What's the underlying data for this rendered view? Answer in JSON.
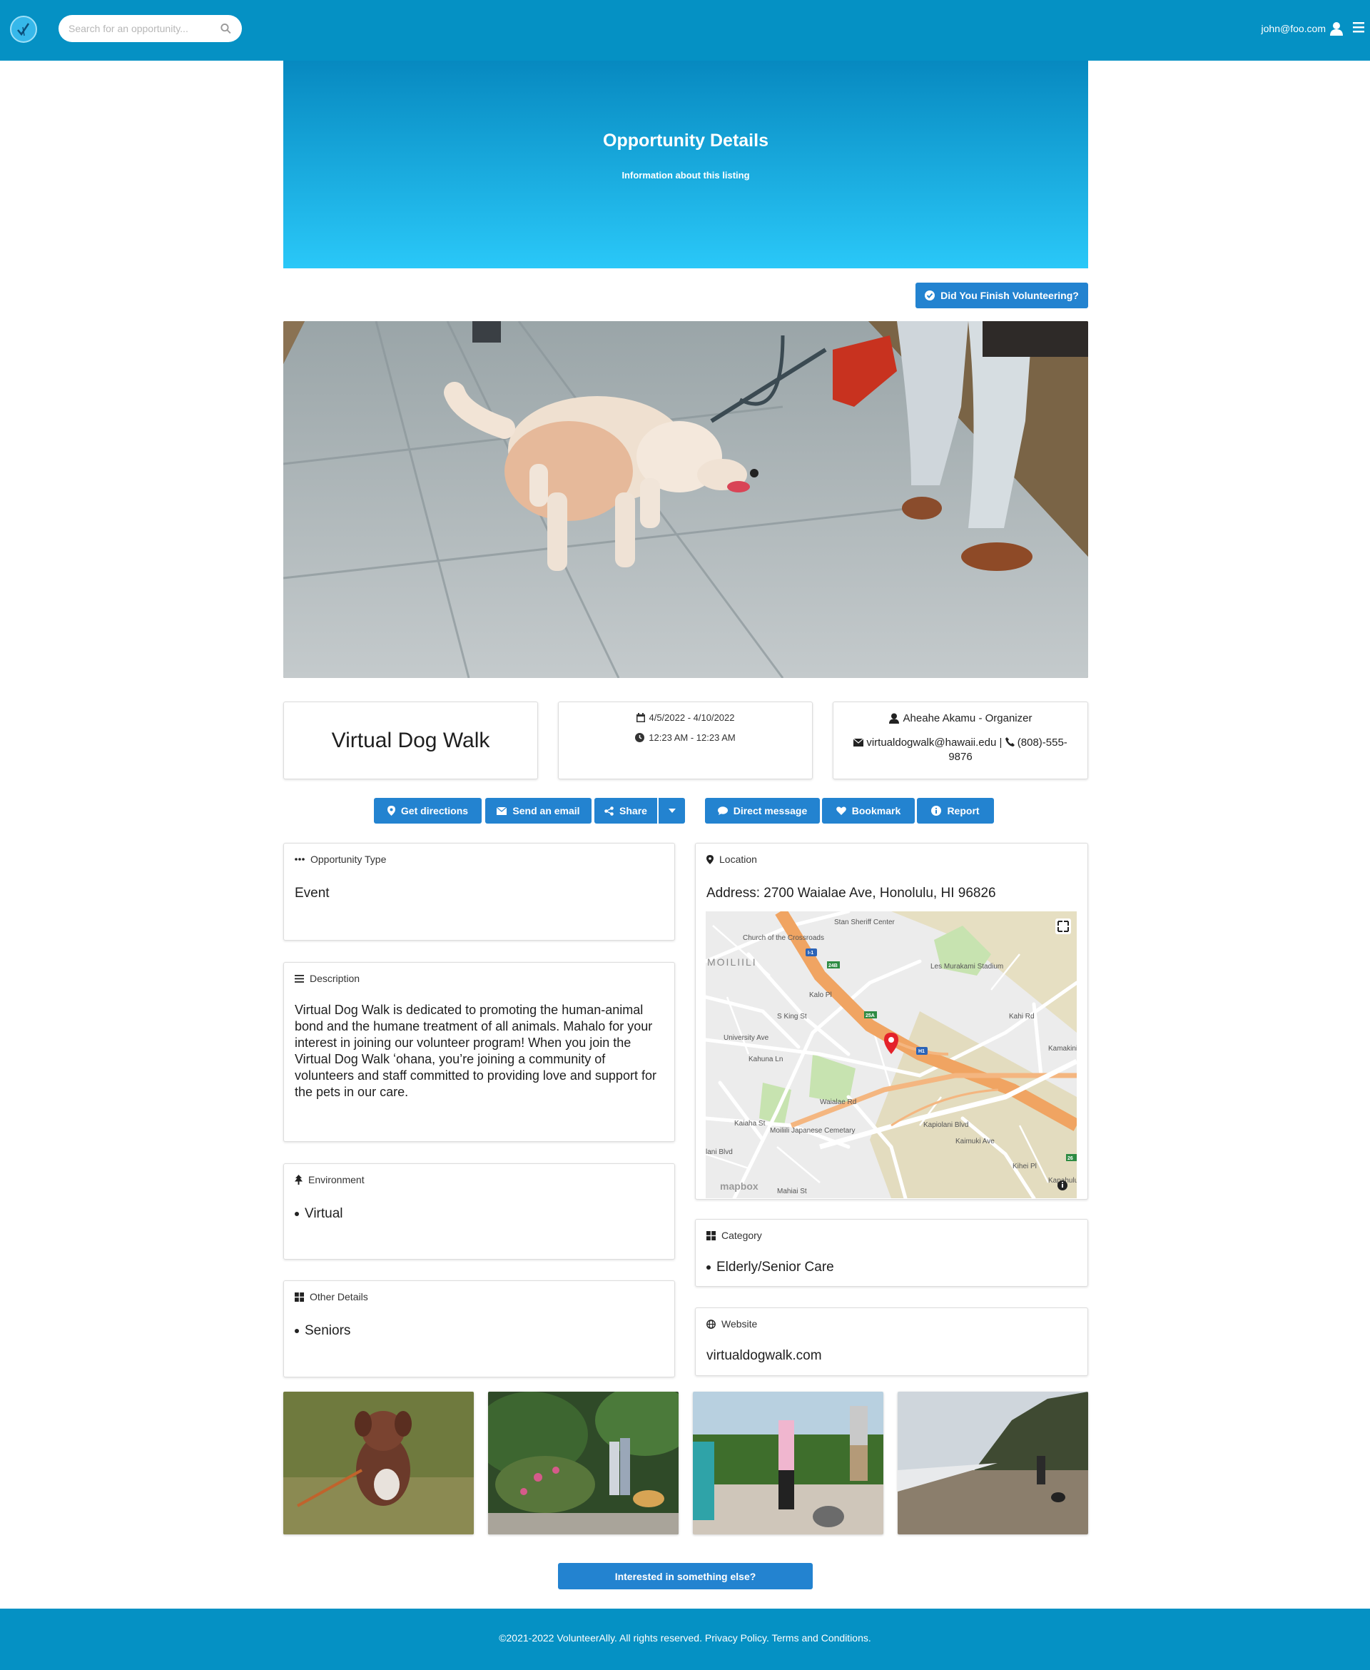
{
  "header": {
    "search_placeholder": "Search for an opportunity...",
    "user_email": "john@foo.com"
  },
  "hero": {
    "title": "Opportunity Details",
    "subtitle": "Information about this listing"
  },
  "finish_button": "Did You Finish Volunteering?",
  "opportunity": {
    "title": "Virtual Dog Walk",
    "date_range": "4/5/2022 - 4/10/2022",
    "time_range": "12:23 AM - 12:23 AM",
    "organizer": "Aheahe Akamu - Organizer",
    "email": "virtualdogwalk@hawaii.edu",
    "phone_separator": "|",
    "phone": "(808)-555-9876"
  },
  "actions": {
    "directions": "Get directions",
    "email": "Send an email",
    "share": "Share",
    "direct_message": "Direct message",
    "bookmark": "Bookmark",
    "report": "Report"
  },
  "sections": {
    "type": {
      "label": "Opportunity Type",
      "value": "Event"
    },
    "description": {
      "label": "Description",
      "value": "Virtual Dog Walk is dedicated to promoting the human-animal bond and the humane treatment of all animals. Mahalo for your interest in joining our volunteer program! When you join the Virtual Dog Walk ʻohana, you’re joining a community of volunteers and staff committed to providing love and support for the pets in our care."
    },
    "environment": {
      "label": "Environment",
      "items": [
        "Virtual"
      ]
    },
    "other": {
      "label": "Other Details",
      "items": [
        "Seniors"
      ]
    },
    "location": {
      "label": "Location",
      "address": "Address: 2700 Waialae Ave, Honolulu, HI 96826"
    },
    "category": {
      "label": "Category",
      "items": [
        "Elderly/Senior Care"
      ]
    },
    "website": {
      "label": "Website",
      "value": "virtualdogwalk.com"
    }
  },
  "map": {
    "labels": [
      "Stan Sheriff Center",
      "Church of the Crossroads",
      "Les Murakami Stadium",
      "MOILIILI",
      "Kalo Pl",
      "S King St",
      "University Ave",
      "Kahuna Ln",
      "Kapiolani Blvd",
      "Kaimuki Ave",
      "Moiliili Japanese Cemetary",
      "Kaiaha St",
      "Waialae Rd",
      "Kamakini",
      "Kahi Rd",
      "Kihei Pl",
      "Kapahulu Ave",
      "lani Blvd",
      "Mahiai St"
    ],
    "attribution": "mapbox",
    "shields": [
      "I-1",
      "H1",
      "25A",
      "24B",
      "26"
    ]
  },
  "interested_button": "Interested in something else?",
  "footer": "©2021-2022 VolunteerAlly. All rights reserved. Privacy Policy. Terms and Conditions.",
  "colors": {
    "primary": "#0591c4",
    "button": "#2383d0"
  },
  "icons": {
    "logo": "volunteerally-logo",
    "search": "search-icon",
    "user": "user-icon",
    "menu": "menu-icon"
  }
}
